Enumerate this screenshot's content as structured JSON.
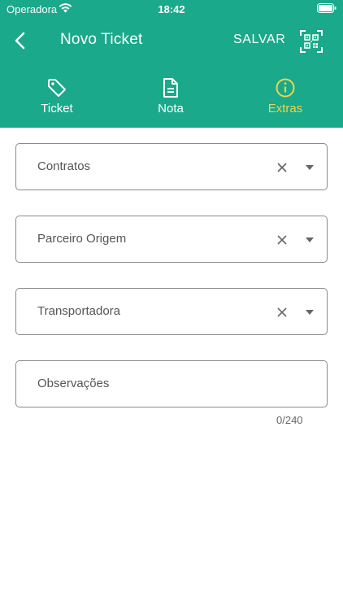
{
  "status_bar": {
    "carrier": "Operadora",
    "time": "18:42"
  },
  "app_bar": {
    "title": "Novo Ticket",
    "save_label": "SALVAR"
  },
  "tabs": [
    {
      "label": "Ticket",
      "icon": "tag-icon",
      "active": false
    },
    {
      "label": "Nota",
      "icon": "document-icon",
      "active": false
    },
    {
      "label": "Extras",
      "icon": "info-icon",
      "active": true
    }
  ],
  "fields": {
    "contratos": {
      "placeholder": "Contratos"
    },
    "parceiro_origem": {
      "placeholder": "Parceiro Origem"
    },
    "transportadora": {
      "placeholder": "Transportadora"
    },
    "observacoes": {
      "placeholder": "Observações",
      "counter": "0/240"
    }
  },
  "colors": {
    "primary": "#1aa98a",
    "active_tab": "#f2d34a"
  }
}
